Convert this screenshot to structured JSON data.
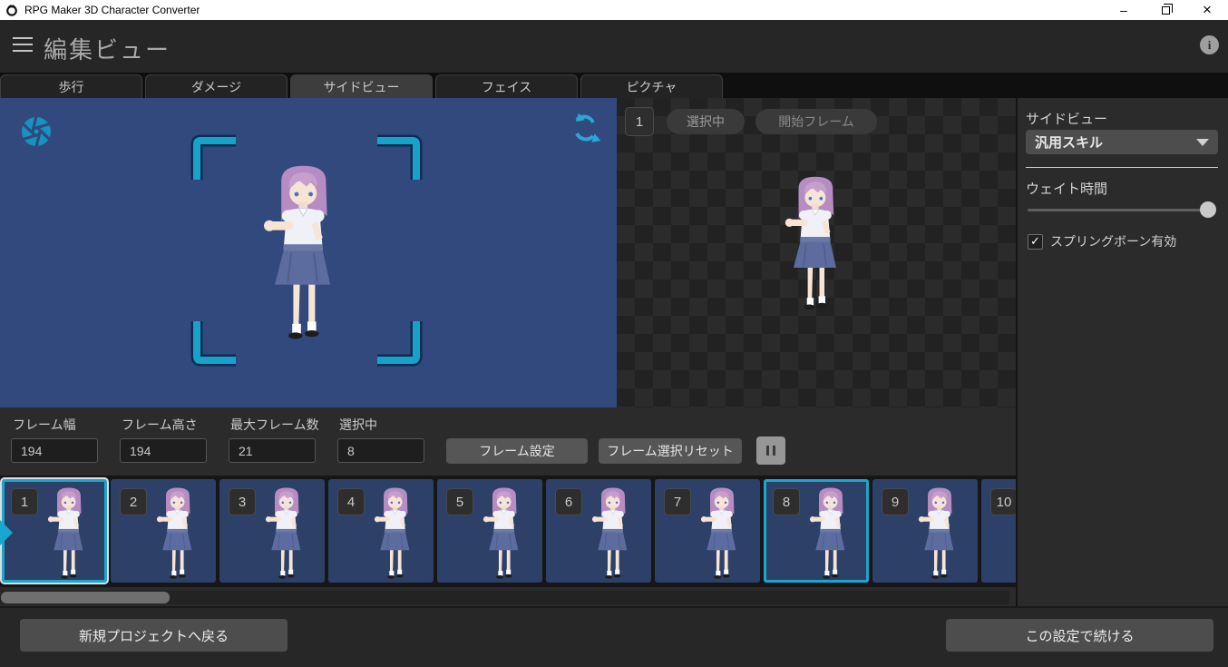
{
  "window": {
    "title": "RPG Maker 3D Character Converter",
    "minimize": "–",
    "close": "×"
  },
  "header": {
    "title": "編集ビュー",
    "info_glyph": "i"
  },
  "tabs": [
    {
      "label": "歩行",
      "selected": false
    },
    {
      "label": "ダメージ",
      "selected": false
    },
    {
      "label": "サイドビュー",
      "selected": true
    },
    {
      "label": "フェイス",
      "selected": false
    },
    {
      "label": "ピクチャ",
      "selected": false
    }
  ],
  "sheet_overlay": {
    "frame_badge": "1",
    "selected_label": "選択中",
    "start_frame_label": "開始フレーム"
  },
  "sidebar": {
    "title": "サイドビュー",
    "motion_dropdown_value": "汎用スキル",
    "wait_time_label": "ウェイト時間",
    "spring_bone_label": "スプリングボーン有効",
    "spring_bone_checked": true
  },
  "frame_settings": {
    "fields": [
      {
        "label": "フレーム幅",
        "value": "194"
      },
      {
        "label": "フレーム高さ",
        "value": "194"
      },
      {
        "label": "最大フレーム数",
        "value": "21"
      },
      {
        "label": "選択中",
        "value": "8"
      }
    ],
    "frame_set_button": "フレーム設定",
    "frame_reset_button": "フレーム選択リセット"
  },
  "filmstrip": {
    "frames": [
      {
        "number": "1",
        "selected": true
      },
      {
        "number": "2",
        "selected": false
      },
      {
        "number": "3",
        "selected": false
      },
      {
        "number": "4",
        "selected": false
      },
      {
        "number": "5",
        "selected": false
      },
      {
        "number": "6",
        "selected": false
      },
      {
        "number": "7",
        "selected": false
      },
      {
        "number": "8",
        "selected": true
      },
      {
        "number": "9",
        "selected": false
      },
      {
        "number": "10",
        "selected": false
      }
    ]
  },
  "footer": {
    "back_button": "新規プロジェクトへ戻る",
    "continue_button": "この設定で続ける"
  },
  "icons": {
    "check": "✓"
  },
  "colors": {
    "accent_cyan": "#1ba6cf",
    "preview_blue": "#31497c",
    "frame_blue": "#2c4068",
    "panel_dark": "#2b2b2b",
    "header_dark": "#262626"
  }
}
